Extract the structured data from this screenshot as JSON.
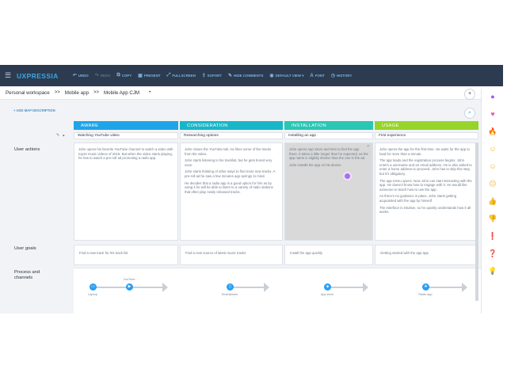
{
  "app": {
    "logo": "UXPRESSIA",
    "toolbar": [
      {
        "icon": "↶",
        "label": "UNDO",
        "dim": false,
        "name": "undo"
      },
      {
        "icon": "↷",
        "label": "REDO",
        "dim": true,
        "name": "redo"
      },
      {
        "icon": "⧉",
        "label": "COPY",
        "dim": false,
        "name": "copy"
      },
      {
        "icon": "▣",
        "label": "PRESENT",
        "dim": false,
        "name": "present"
      },
      {
        "icon": "⤢",
        "label": "FULLSCREEN",
        "dim": false,
        "name": "fullscreen"
      },
      {
        "icon": "⇪",
        "label": "EXPORT",
        "dim": false,
        "name": "export"
      },
      {
        "icon": "✎",
        "label": "HIDE COMMENTS",
        "dim": false,
        "name": "hide-comments"
      },
      {
        "icon": "◉",
        "label": "DEFAULT VIEW ▾",
        "dim": false,
        "name": "default-view"
      },
      {
        "icon": "A",
        "label": "FONT",
        "dim": false,
        "name": "font"
      },
      {
        "icon": "◷",
        "label": "HISTORY",
        "dim": false,
        "name": "history"
      }
    ]
  },
  "breadcrumb": {
    "workspace": "Personal workspace",
    "project": "Mobile app",
    "map": "Mobile App CJM",
    "sep": ">>",
    "dot": "•"
  },
  "board": {
    "add_description": "+ ADD MAP DESCRIPTION",
    "row_labels": {
      "actions": "User actions",
      "goals": "User goals",
      "channels": "Process and\nchannels"
    },
    "stages": [
      {
        "label": "AWARE",
        "color": "#1fa4e8",
        "sub": "Watching YouTube video"
      },
      {
        "label": "CONSIDERATION",
        "color": "#19b6c8",
        "sub": "Researching options"
      },
      {
        "label": "INSTALLATION",
        "color": "#2bc6b4",
        "sub": "Installing an app"
      },
      {
        "label": "USAGE",
        "color": "#97d42a",
        "sub": "First experience"
      }
    ],
    "cards": [
      [
        "John opens his favorite YouTube channel to watch a video with top10 music videos of 2019. But when the video starts playing, he has to watch a pre-roll ad promoting a radio app."
      ],
      [
        "John closes the YouTube tab. He likes some of the tracks from the video.",
        "John starts listening to his tracklist, but he gets bored very soon.",
        "John starts thinking of other ways to find more new tracks. A pre-roll ad he saw a few minutes ago springs to mind.",
        "He decides that a radio app is a good option for him as by using it he will be able to listen to a variety of radio stations that often play newly released tracks."
      ],
      [
        "John opens App Store and tries to find the app there. It takes a little longer than he expected, as the app name is slightly shorter than the one in the ad.",
        "John installs the app on his device."
      ],
      [
        "John opens the app for the first time. He waits for the app to load for more than a minute.",
        "The app loads and the registration process begins. John enters a username and an email address. He is also asked to enter a home address to proceed. John has to skip this step, but it's obligatory.",
        "The app menu opens. Now John can start interacting with the app. He doesn't know how to engage with it. He would like someone to teach how to use the app.",
        "As there's no guidance in place, John starts getting acquainted with the app by himself.",
        "The interface is intuitive, so he quickly understands how it all works."
      ]
    ],
    "goals": [
      "Find a new track for his track list",
      "Find a new source of latest music tracks",
      "Install the app quickly",
      "Getting started with the app app"
    ],
    "channels": [
      {
        "top": "YouTube",
        "labels": [
          "Laptop",
          ""
        ],
        "nodes": [
          "▭",
          "▶"
        ]
      },
      {
        "top": "",
        "labels": [
          "Smartphone"
        ],
        "nodes": [
          "▯"
        ]
      },
      {
        "top": "",
        "labels": [
          "App store"
        ],
        "nodes": [
          "◈"
        ]
      },
      {
        "top": "",
        "labels": [
          "Radio app"
        ],
        "nodes": [
          "★"
        ]
      }
    ]
  }
}
